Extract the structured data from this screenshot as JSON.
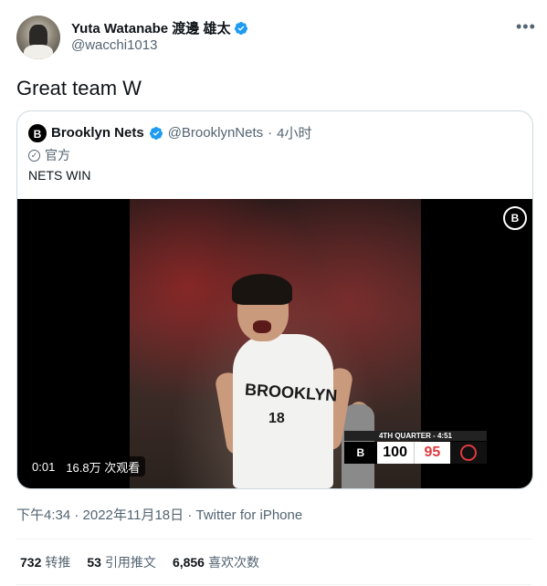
{
  "author": {
    "display_name": "Yuta Watanabe 渡邊 雄太",
    "handle": "@wacchi1013",
    "more_icon": "more-horizontal-icon"
  },
  "tweet": {
    "text": "Great team W",
    "timestamp": "下午4:34 · 2022年11月18日 · Twitter for iPhone"
  },
  "quote": {
    "name": "Brooklyn Nets",
    "handle": "@BrooklynNets",
    "age": "4小时",
    "official_label": "官方",
    "text": "NETS WIN",
    "logo_letter": "B",
    "video": {
      "elapsed": "0:01",
      "views": "16.8万 次观看",
      "jersey_text": "BROOKLYN",
      "jersey_number": "18",
      "scorebug": {
        "quarter": "4TH QUARTER - 4:51",
        "home_abbr": "B",
        "home_score": "100",
        "away_score": "95"
      }
    }
  },
  "stats": [
    {
      "count": "732",
      "label": "转推"
    },
    {
      "count": "53",
      "label": "引用推文"
    },
    {
      "count": "6,856",
      "label": "喜欢次数"
    }
  ],
  "colors": {
    "verified": "#1d9bf0",
    "secondary_text": "#536471",
    "primary_text": "#0f1419",
    "blazers_red": "#e03a3e"
  }
}
